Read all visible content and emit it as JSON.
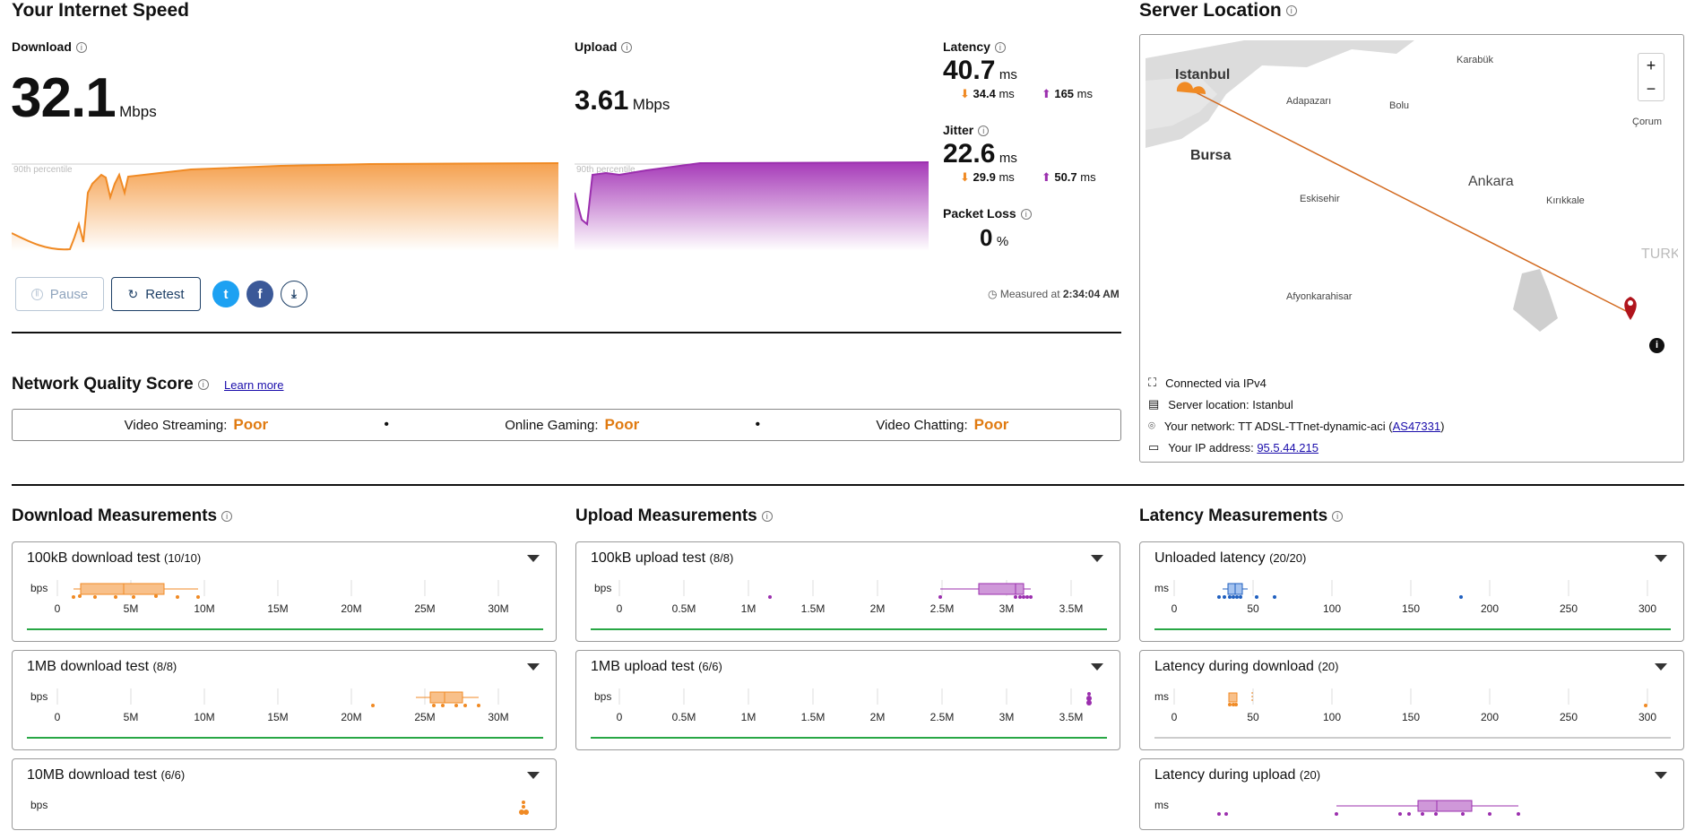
{
  "speed": {
    "title": "Your Internet Speed",
    "download": {
      "label": "Download",
      "value": "32.1",
      "unit": "Mbps"
    },
    "upload": {
      "label": "Upload",
      "value": "3.61",
      "unit": "Mbps"
    },
    "percentile_label": "90th percentile",
    "latency": {
      "label": "Latency",
      "value": "40.7",
      "unit": "ms",
      "down": "34.4",
      "up": "165",
      "sub_unit": "ms"
    },
    "jitter": {
      "label": "Jitter",
      "value": "22.6",
      "unit": "ms",
      "down": "29.9",
      "up": "50.7",
      "sub_unit": "ms"
    },
    "packet_loss": {
      "label": "Packet Loss",
      "value": "0",
      "unit": "%"
    },
    "pause_label": "Pause",
    "retest_label": "Retest",
    "measured_prefix": "Measured at",
    "measured_time": "2:34:04 AM"
  },
  "server": {
    "title": "Server Location",
    "cities": [
      "Istanbul",
      "Bursa",
      "Adapazarı",
      "Bolu",
      "Karabük",
      "Çorum",
      "Ankara",
      "Kırıkkale",
      "Eskisehir",
      "Afyonkarahisar",
      "TURK"
    ],
    "zoom_in": "+",
    "zoom_out": "−",
    "info_glyph": "i",
    "connected": "Connected via IPv4",
    "location": "Server location: Istanbul",
    "network_prefix": "Your network: TT ADSL-TTnet-dynamic-aci (",
    "network_as": "AS47331",
    "network_suffix": ")",
    "ip_prefix": "Your IP address: ",
    "ip": "95.5.44.215"
  },
  "quality": {
    "title": "Network Quality Score",
    "learn_more": "Learn more",
    "items": [
      {
        "label": "Video Streaming:",
        "value": "Poor"
      },
      {
        "label": "Online Gaming:",
        "value": "Poor"
      },
      {
        "label": "Video Chatting:",
        "value": "Poor"
      }
    ],
    "separator": "•"
  },
  "measurements": {
    "download_title": "Download Measurements",
    "upload_title": "Upload Measurements",
    "latency_title": "Latency Measurements",
    "bps": "bps",
    "ms": "ms",
    "dl_ticks": [
      "0",
      "5M",
      "10M",
      "15M",
      "20M",
      "25M",
      "30M"
    ],
    "ul_ticks": [
      "0",
      "0.5M",
      "1M",
      "1.5M",
      "2M",
      "2.5M",
      "3M",
      "3.5M"
    ],
    "lat_ticks": [
      "0",
      "50",
      "100",
      "150",
      "200",
      "250",
      "300"
    ],
    "cards": {
      "dl100k": {
        "title": "100kB download test",
        "count": "(10/10)"
      },
      "dl1m": {
        "title": "1MB download test",
        "count": "(8/8)"
      },
      "dl10m": {
        "title": "10MB download test",
        "count": "(6/6)"
      },
      "ul100k": {
        "title": "100kB upload test",
        "count": "(8/8)"
      },
      "ul1m": {
        "title": "1MB upload test",
        "count": "(6/6)"
      },
      "lat_unloaded": {
        "title": "Unloaded latency",
        "count": "(20/20)"
      },
      "lat_down": {
        "title": "Latency during download",
        "count": "(20)"
      },
      "lat_up": {
        "title": "Latency during upload",
        "count": "(20)"
      }
    }
  },
  "colors": {
    "download": "#f08a24",
    "upload": "#9b2fae",
    "latency": "#1f5fbf",
    "poor": "#e07a10",
    "good_line": "#28a745"
  }
}
